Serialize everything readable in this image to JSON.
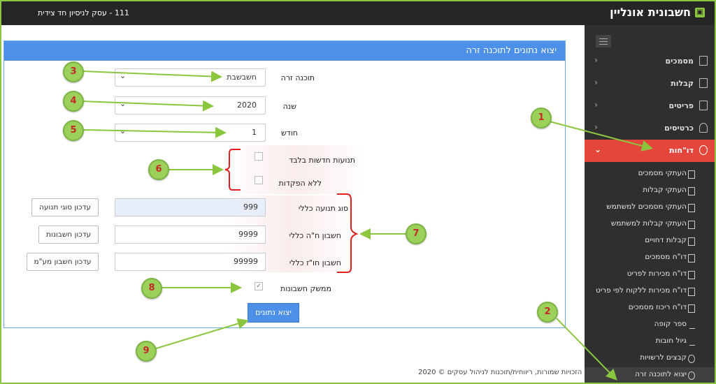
{
  "topbar": {
    "brand": "חשבונית אונליין",
    "company": "111 - עסק לניסיון חד צידית"
  },
  "sidebar": {
    "items": [
      {
        "label": "מסמכים",
        "icon": "document-icon"
      },
      {
        "label": "קבלות",
        "icon": "document-icon"
      },
      {
        "label": "פריטים",
        "icon": "gift-icon"
      },
      {
        "label": "כרטיסים",
        "icon": "user-icon"
      },
      {
        "label": "דו\"חות",
        "icon": "pie-chart-icon"
      }
    ],
    "reports": [
      "העתקי מסמכים",
      "העתקי קבלות",
      "העתקי מסמכים למשתמש",
      "העתקי קבלות למשתמש",
      "קבלות דחויים",
      "דו\"ח מסמכים",
      "דו\"ח מכירות לפריט",
      "דו\"ח מכירות ללקוח לפי פריט",
      "דו\"ח ריכוז מסמכים",
      "ספר קופה",
      "גיול חובות",
      "קבצים לרשויות",
      "יצוא לתוכנה זרה"
    ]
  },
  "panel": {
    "title": "יצוא נתונים לתוכנה זרה",
    "software_label": "תוכנה זרה",
    "software_value": "חשבשבת",
    "year_label": "שנה",
    "year_value": "2020",
    "month_label": "חודש",
    "month_value": "1",
    "new_only_label": "תנועות חדשות בלבד",
    "no_deposits_label": "ללא הפקדות",
    "txn_type_label": "סוג תנועה כללי",
    "txn_type_value": "999",
    "txn_type_button": "עדכון סוגי תנועה",
    "general_account_label": "חשבון ח\"ה כללי",
    "general_account_value": "9999",
    "general_account_button": "עדכון חשבונות",
    "foreign_account_label": "חשבון חו\"ז כללי",
    "foreign_account_value": "99999",
    "foreign_account_button": "עדכון חשבון מע\"מ",
    "interface_label": "ממשק חשבונות",
    "export_button": "יצוא נתונים"
  },
  "footer": "כל הזכויות שמורות, ריווחית/תוכנות לניהול עסקים © 2020",
  "annotations": [
    "1",
    "2",
    "3",
    "4",
    "5",
    "6",
    "7",
    "8",
    "9"
  ],
  "colors": {
    "accent": "#4d90e8",
    "active": "#e4463b",
    "marker": "#9bd05a",
    "arrow": "#8cc63f",
    "bracket": "#e02020"
  }
}
